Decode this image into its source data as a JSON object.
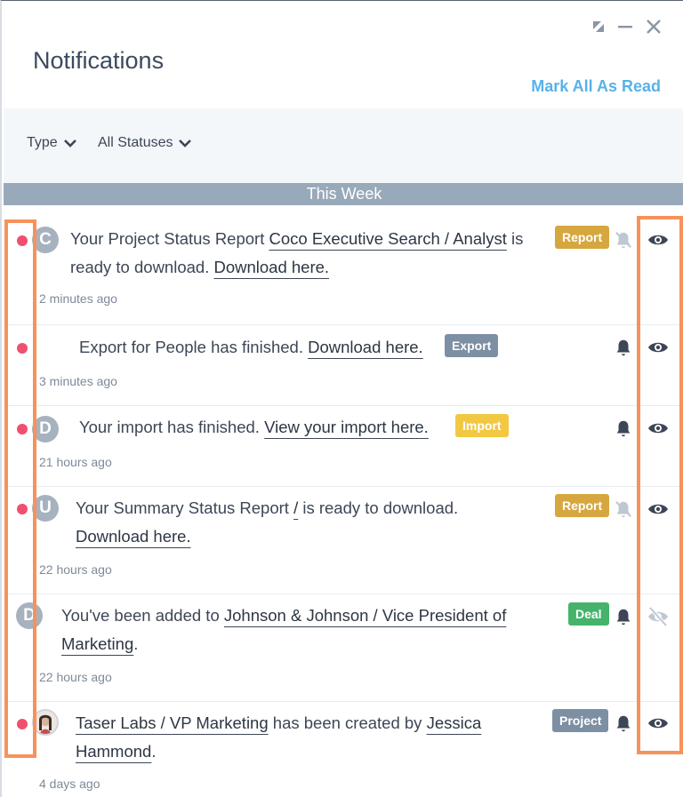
{
  "header": {
    "title": "Notifications",
    "mark_all_read": "Mark All As Read"
  },
  "filters": {
    "type_label": "Type",
    "status_label": "All Statuses"
  },
  "section_label": "This Week",
  "colors": {
    "accent": "#59b1e8",
    "unread_dot": "#f0506e",
    "highlight_box": "#f6925a",
    "report": "#d6a73e",
    "export": "#7d8fa3",
    "import": "#f2c842",
    "deal": "#45b46a",
    "project": "#7d8fa3"
  },
  "notifications": [
    {
      "avatar": "C",
      "unread": true,
      "parts": [
        "Your Project Status Report ",
        "Coco Executive Search / Analyst",
        " is",
        "ready to download. ",
        "Download here."
      ],
      "time": "2 minutes ago",
      "badge": "Report",
      "bell": "bell-muted-icon",
      "eye": "eye-icon"
    },
    {
      "avatar": "",
      "unread": true,
      "parts": [
        "Export for People has finished. ",
        "Download here."
      ],
      "time": "3 minutes ago",
      "badge": "Export",
      "bell": "bell-icon",
      "eye": "eye-icon"
    },
    {
      "avatar": "D",
      "unread": true,
      "parts": [
        "Your import has finished. ",
        "View your import here."
      ],
      "time": "21 hours ago",
      "badge": "Import",
      "bell": "bell-icon",
      "eye": "eye-icon"
    },
    {
      "avatar": "U",
      "unread": true,
      "parts": [
        "Your Summary Status Report ",
        "/",
        " is ready to download.",
        "Download here."
      ],
      "time": "22 hours ago",
      "badge": "Report",
      "bell": "bell-muted-icon",
      "eye": "eye-icon"
    },
    {
      "avatar": "D",
      "unread": false,
      "parts": [
        "You've been added to ",
        "Johnson & Johnson / Vice President of",
        "Marketing",
        "."
      ],
      "time": "22 hours ago",
      "badge": "Deal",
      "bell": "bell-icon",
      "eye": "eye-off-icon"
    },
    {
      "avatar": "",
      "unread": true,
      "parts": [
        "Taser Labs / VP Marketing",
        " has been created by ",
        "Jessica",
        "Hammond",
        "."
      ],
      "time": "4 days ago",
      "badge": "Project",
      "bell": "bell-icon",
      "eye": "eye-icon"
    }
  ]
}
